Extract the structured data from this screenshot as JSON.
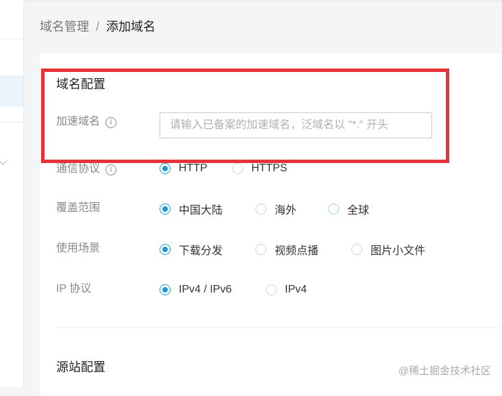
{
  "breadcrumb": {
    "parent": "域名管理",
    "separator": "/",
    "current": "添加域名"
  },
  "domain_config": {
    "section_title": "域名配置",
    "accel_domain": {
      "label": "加速域名",
      "info_icon": "i",
      "value": "",
      "placeholder": "请输入已备案的加速域名，泛域名以 \"*.\" 开头"
    },
    "protocol": {
      "label": "通信协议",
      "info_icon": "i",
      "options": [
        "HTTP",
        "HTTPS"
      ],
      "selected": "HTTP"
    },
    "coverage": {
      "label": "覆盖范围",
      "options": [
        "中国大陆",
        "海外",
        "全球"
      ],
      "selected": "中国大陆"
    },
    "scenario": {
      "label": "使用场景",
      "options": [
        "下载分发",
        "视频点播",
        "图片小文件"
      ],
      "selected": "下载分发"
    },
    "ip_protocol": {
      "label": "IP 协议",
      "options": [
        "IPv4 / IPv6",
        "IPv4"
      ],
      "selected": "IPv4 / IPv6"
    }
  },
  "origin_config": {
    "section_title": "源站配置"
  },
  "watermark": "@稀土掘金技术社区",
  "colors": {
    "accent": "#1a9bd7",
    "highlight_box": "#e8323a"
  }
}
